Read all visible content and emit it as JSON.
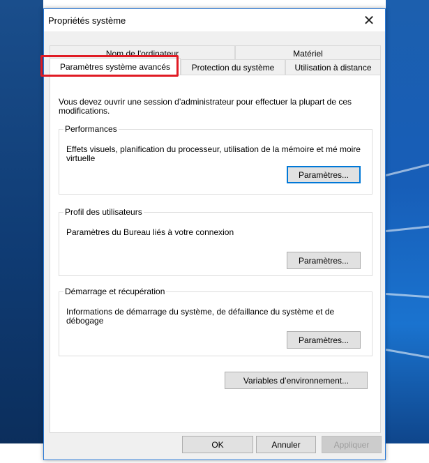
{
  "dialog": {
    "title": "Propriétés système",
    "close_glyph": "✕"
  },
  "tabs": {
    "back": [
      {
        "label": "Nom de l'ordinateur"
      },
      {
        "label": "Matériel"
      }
    ],
    "front": [
      {
        "label": "Paramètres système avancés",
        "active": true
      },
      {
        "label": "Protection du système"
      },
      {
        "label": "Utilisation à distance"
      }
    ]
  },
  "panel": {
    "intro": "Vous devez ouvrir une session d’administrateur pour effectuer la plupart de ces modifications.",
    "performance": {
      "title": "Performances",
      "text": "Effets visuels, planification du processeur, utilisation de la mémoire et mé moire virtuelle",
      "button": "Paramètres..."
    },
    "profiles": {
      "title": "Profil des utilisateurs",
      "text": "Paramètres du Bureau liés à votre connexion",
      "button": "Paramètres..."
    },
    "startup": {
      "title": "Démarrage et récupération",
      "text": "Informations de démarrage du système, de défaillance du système et de débogage",
      "button": "Paramètres..."
    },
    "env_button": "Variables d’environnement..."
  },
  "footer": {
    "ok": "OK",
    "cancel": "Annuler",
    "apply": "Appliquer"
  },
  "colors": {
    "highlight": "#e01b24",
    "accent": "#0078d7"
  }
}
